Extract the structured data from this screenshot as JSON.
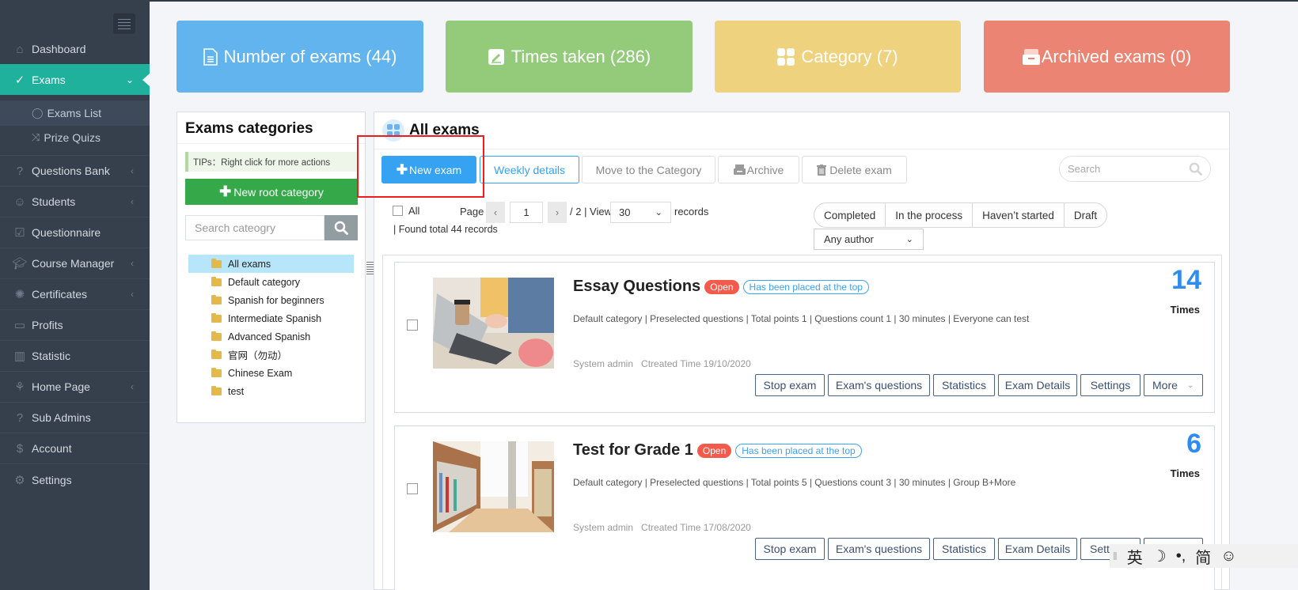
{
  "sidebar": {
    "toggle_icon": "hamburger-icon",
    "items": [
      {
        "label": "Dashboard",
        "icon": "home-icon",
        "has_arrow": false
      },
      {
        "label": "Exams",
        "icon": "check-circle-icon",
        "has_arrow": true,
        "active": true
      },
      {
        "label": "Questions Bank",
        "icon": "question-circle-icon",
        "has_arrow": true
      },
      {
        "label": "Students",
        "icon": "users-icon",
        "has_arrow": true
      },
      {
        "label": "Questionnaire",
        "icon": "checkbox-icon",
        "has_arrow": false
      },
      {
        "label": "Course Manager",
        "icon": "graduation-cap-icon",
        "has_arrow": true
      },
      {
        "label": "Certificates",
        "icon": "certificate-icon",
        "has_arrow": true
      },
      {
        "label": "Profits",
        "icon": "credit-card-icon",
        "has_arrow": false
      },
      {
        "label": "Statistic",
        "icon": "bar-chart-icon",
        "has_arrow": false
      },
      {
        "label": "Home Page",
        "icon": "leaf-icon",
        "has_arrow": true
      },
      {
        "label": "Sub Admins",
        "icon": "question-circle-icon",
        "has_arrow": false
      },
      {
        "label": "Account",
        "icon": "dollar-icon",
        "has_arrow": false
      },
      {
        "label": "Settings",
        "icon": "gear-icon",
        "has_arrow": false
      }
    ],
    "sub_items": [
      {
        "label": "Exams List",
        "icon": "check-circle-icon",
        "current": true
      },
      {
        "label": "Prize Quizs",
        "icon": "shuffle-icon",
        "current": false
      }
    ]
  },
  "stats": [
    {
      "label": "Number of exams (44)",
      "icon": "document-icon",
      "color": "#62b4ee"
    },
    {
      "label": "Times taken (286)",
      "icon": "edit-icon",
      "color": "#93cb7b"
    },
    {
      "label": "Category (7)",
      "icon": "grid-icon",
      "color": "#efd27d"
    },
    {
      "label": "Archived exams (0)",
      "icon": "archive-icon",
      "color": "#eb8472"
    }
  ],
  "categories": {
    "title": "Exams categories",
    "tips": "TIPs：Right click for more actions",
    "new_root_label": "New root category",
    "search_placeholder": "Search cateogry",
    "items": [
      {
        "label": "All exams",
        "selected": true
      },
      {
        "label": "Default category"
      },
      {
        "label": "Spanish for beginners"
      },
      {
        "label": "Intermediate Spanish"
      },
      {
        "label": "Advanced Spanish"
      },
      {
        "label": "官网（勿动）"
      },
      {
        "label": "Chinese Exam"
      },
      {
        "label": "test"
      }
    ]
  },
  "main": {
    "title": "All exams",
    "toolbar": {
      "new_exam": "New exam",
      "weekly_details": "Weekly details",
      "move_category": "Move to the Category",
      "archive": "Archive",
      "delete_exam": "Delete exam"
    },
    "search_placeholder": "Search",
    "pagination": {
      "all_label": "All",
      "page_label": "Page",
      "page_value": "1",
      "total_pages": "/ 2 | View",
      "per_page": "30",
      "records_label": "records",
      "found_total": "| Found total 44 records"
    },
    "status_filters": [
      "Completed",
      "In the process",
      "Haven’t started",
      "Draft"
    ],
    "author_filter": "Any author",
    "exams": [
      {
        "title": "Essay Questions",
        "status": "Open",
        "pinned": "Has been placed at the top",
        "meta": "Default category | Preselected questions | Total points 1 | Questions count 1 | 30 minutes | Everyone can test",
        "author": "System admin",
        "created": "Ctreated Time 19/10/2020",
        "count": "14",
        "count_label": "Times"
      },
      {
        "title": "Test for Grade 1",
        "status": "Open",
        "pinned": "Has been placed at the top",
        "meta": "Default category | Preselected questions | Total points 5 | Questions count 3 | 30 minutes | Group B+More",
        "author": "System admin",
        "created": "Ctreated Time 17/08/2020",
        "count": "6",
        "count_label": "Times"
      }
    ],
    "actions": [
      "Stop exam",
      "Exam's questions",
      "Statistics",
      "Exam Details",
      "Settings",
      "More"
    ]
  },
  "ime": {
    "items": [
      "英",
      "☽",
      "•,",
      "简",
      "☺"
    ]
  }
}
